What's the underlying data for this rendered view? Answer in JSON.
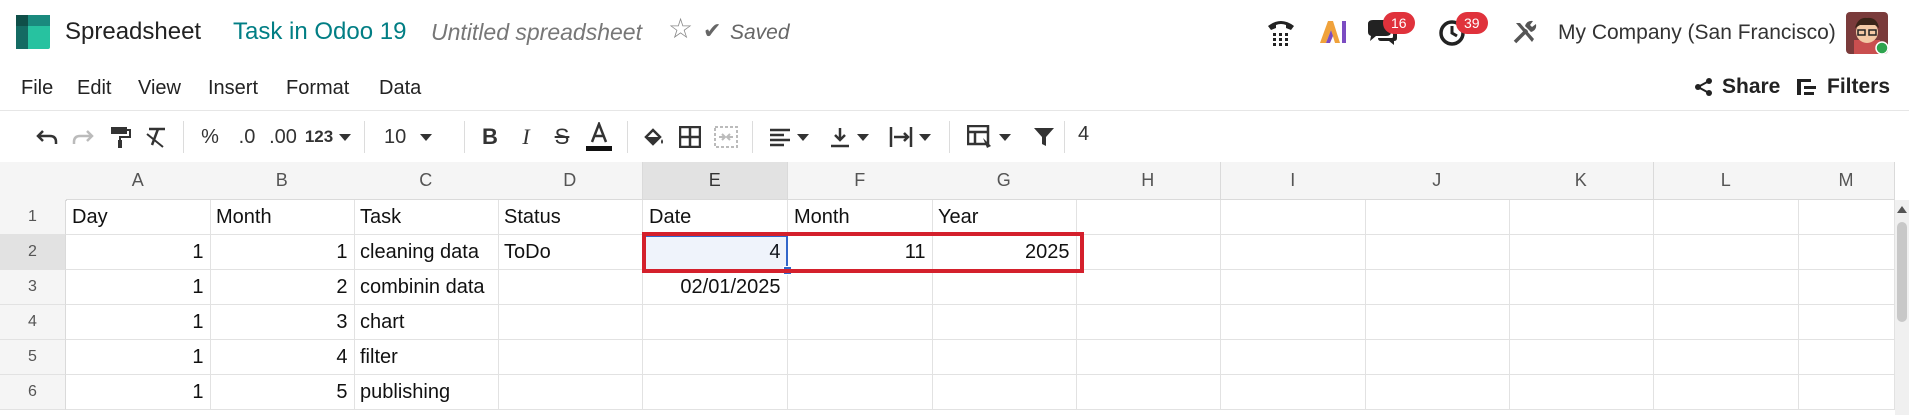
{
  "header": {
    "app_name": "Spreadsheet",
    "breadcrumb_link": "Task in Odoo 19",
    "breadcrumb_current": "Untitled spreadsheet",
    "save_status": "Saved",
    "company": "My Company (San Francisco)",
    "messages_badge": "16",
    "activities_badge": "39",
    "brand_color": "#017e84",
    "badge_color": "#e0323c"
  },
  "menu": {
    "items": [
      "File",
      "Edit",
      "View",
      "Insert",
      "Format",
      "Data"
    ],
    "share_label": "Share",
    "filters_label": "Filters"
  },
  "toolbar": {
    "percent_label": "%",
    "decrease_decimal_label": ".0",
    "increase_decimal_label": ".00",
    "more_formats_label": "123",
    "font_size": "10",
    "formula_value": "4"
  },
  "grid": {
    "columns": [
      "A",
      "B",
      "C",
      "D",
      "E",
      "F",
      "G",
      "H",
      "I",
      "J",
      "K",
      "L",
      "M"
    ],
    "rows": [
      "1",
      "2",
      "3",
      "4",
      "5",
      "6"
    ],
    "cells": {
      "A1": "Day",
      "B1": "Month",
      "C1": "Task",
      "D1": "Status",
      "E1": "Date",
      "F1": "Month",
      "G1": "Year",
      "A2": "1",
      "B2": "1",
      "C2": "cleaning data",
      "D2": "ToDo",
      "E2": "4",
      "F2": "11",
      "G2": "2025",
      "A3": "1",
      "B3": "2",
      "C3": "combinin data",
      "E3": "02/01/2025",
      "A4": "1",
      "B4": "3",
      "C4": "chart",
      "A5": "1",
      "B5": "4",
      "C5": "filter",
      "A6": "1",
      "B6": "5",
      "C6": "publishing"
    },
    "selected_cell": "E2",
    "selection_color": "#3266ca",
    "highlight_color": "#d4202c"
  }
}
